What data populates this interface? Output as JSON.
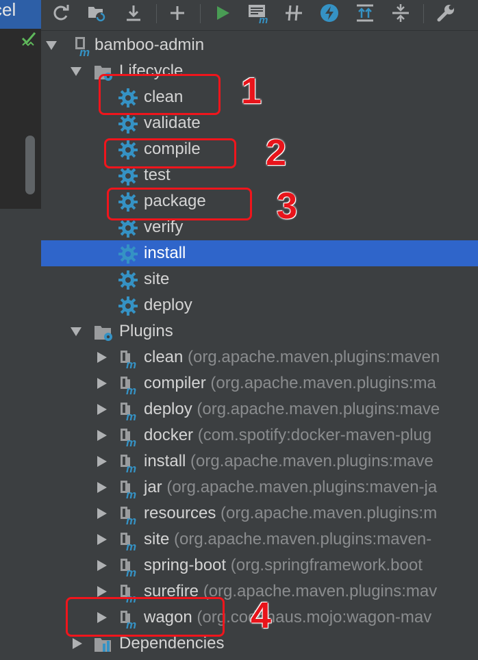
{
  "editor_tab": {
    "text": "cel"
  },
  "toolbar": {
    "buttons": [
      {
        "name": "reimport-icon"
      },
      {
        "name": "generate-sources-icon"
      },
      {
        "name": "download-icon"
      },
      {
        "name": "add-icon"
      },
      {
        "name": "run-icon"
      },
      {
        "name": "execute-goal-icon"
      },
      {
        "name": "toggle-offline-icon"
      },
      {
        "name": "skip-tests-icon"
      },
      {
        "name": "show-dependencies-icon"
      },
      {
        "name": "collapse-all-icon"
      },
      {
        "name": "settings-icon"
      }
    ]
  },
  "colors": {
    "accent_selection": "#2f65ca",
    "gear_blue": "#3592c4",
    "run_green": "#499c54",
    "annotation_red": "#f0151c"
  },
  "tree": {
    "root": {
      "label": "bamboo-admin"
    },
    "lifecycle": {
      "label": "Lifecycle",
      "items": [
        {
          "label": "clean"
        },
        {
          "label": "validate"
        },
        {
          "label": "compile"
        },
        {
          "label": "test"
        },
        {
          "label": "package"
        },
        {
          "label": "verify"
        },
        {
          "label": "install",
          "selected": true
        },
        {
          "label": "site"
        },
        {
          "label": "deploy"
        }
      ]
    },
    "plugins": {
      "label": "Plugins",
      "items": [
        {
          "label": "clean",
          "detail": "(org.apache.maven.plugins:maven"
        },
        {
          "label": "compiler",
          "detail": "(org.apache.maven.plugins:ma"
        },
        {
          "label": "deploy",
          "detail": "(org.apache.maven.plugins:mave"
        },
        {
          "label": "docker",
          "detail": "(com.spotify:docker-maven-plug"
        },
        {
          "label": "install",
          "detail": "(org.apache.maven.plugins:mave"
        },
        {
          "label": "jar",
          "detail": "(org.apache.maven.plugins:maven-ja"
        },
        {
          "label": "resources",
          "detail": "(org.apache.maven.plugins:m"
        },
        {
          "label": "site",
          "detail": "(org.apache.maven.plugins:maven-"
        },
        {
          "label": "spring-boot",
          "detail": "(org.springframework.boot"
        },
        {
          "label": "surefire",
          "detail": "(org.apache.maven.plugins:mav"
        },
        {
          "label": "wagon",
          "detail": "(org.codehaus.mojo:wagon-mav"
        }
      ]
    },
    "dependencies": {
      "label": "Dependencies"
    }
  },
  "annotations": [
    {
      "number": "1"
    },
    {
      "number": "2"
    },
    {
      "number": "3"
    },
    {
      "number": "4"
    }
  ]
}
